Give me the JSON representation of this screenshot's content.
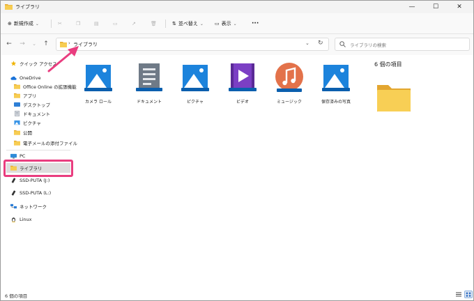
{
  "window": {
    "title": "ライブラリ"
  },
  "toolbar": {
    "new_label": "新規作成",
    "sort_label": "並べ替え",
    "view_label": "表示",
    "more_label": "···"
  },
  "address": {
    "crumb": "ライブラリ",
    "separator": "›"
  },
  "search": {
    "placeholder": "ライブラリの検索"
  },
  "sidebar": {
    "quick_access": "クイック アクセス",
    "onedrive": "OneDrive",
    "onedrive_items": [
      "Office Online の拡張機能",
      "アプリ",
      "デスクトップ",
      "ドキュメント",
      "ピクチャ",
      "公開",
      "電子メールの添付ファイル"
    ],
    "pc": "PC",
    "libraries": "ライブラリ",
    "drives": [
      "SSD-PUTA (J:)",
      "SSD-PUTA (L:)"
    ],
    "network": "ネットワーク",
    "linux": "Linux"
  },
  "libraries": [
    {
      "label": "カメラ ロール",
      "icon": "camera-roll-library-icon"
    },
    {
      "label": "ドキュメント",
      "icon": "documents-library-icon"
    },
    {
      "label": "ピクチャ",
      "icon": "pictures-library-icon"
    },
    {
      "label": "ビデオ",
      "icon": "videos-library-icon"
    },
    {
      "label": "ミュージック",
      "icon": "music-library-icon"
    },
    {
      "label": "保存済みの写真",
      "icon": "saved-pictures-library-icon"
    }
  ],
  "details": {
    "title": "6 個の項目"
  },
  "status": {
    "text": "6 個の項目"
  },
  "colors": {
    "accent": "#0067c0",
    "highlight": "#e93d7f",
    "folder": "#f5c745"
  }
}
